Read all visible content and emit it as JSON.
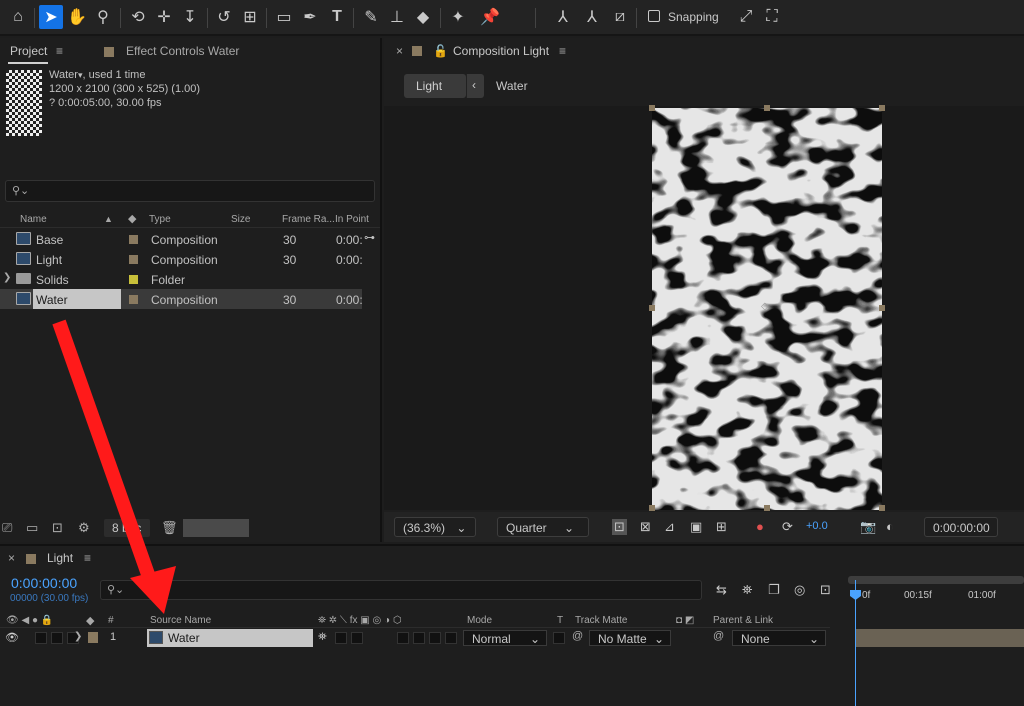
{
  "toolbar": {
    "snapping_label": "Snapping"
  },
  "project_panel": {
    "tab_project": "Project",
    "tab_effect_controls": "Effect Controls Water",
    "selected_item": {
      "name": "Water",
      "usage": ", used 1 time",
      "dimensions": "1200 x 2100  (300 x 525) (1.00)",
      "duration": "? 0:00:05:00, 30.00 fps"
    },
    "columns": {
      "name": "Name",
      "type": "Type",
      "size": "Size",
      "frame_rate": "Frame Ra...",
      "in_point": "In Point"
    },
    "items": [
      {
        "name": "Base",
        "type": "Composition",
        "frame_rate": "30",
        "in_point": "0:00:",
        "color": "#8a7a60",
        "kind": "comp"
      },
      {
        "name": "Light",
        "type": "Composition",
        "frame_rate": "30",
        "in_point": "0:00:",
        "color": "#8a7a60",
        "kind": "comp"
      },
      {
        "name": "Solids",
        "type": "Folder",
        "frame_rate": "",
        "in_point": "",
        "color": "#c8c03a",
        "kind": "folder"
      },
      {
        "name": "Water",
        "type": "Composition",
        "frame_rate": "30",
        "in_point": "0:00:",
        "color": "#8a7a60",
        "kind": "comp"
      }
    ],
    "bpc": "8 bpc"
  },
  "comp_panel": {
    "tab_title": "Composition Light",
    "crumb_active": "Light",
    "crumb_other": "Water",
    "zoom": "(36.3%)",
    "resolution": "Quarter",
    "exposure": "+0.0",
    "timecode": "0:00:00:00"
  },
  "timeline": {
    "tab_title": "Light",
    "timecode": "0:00:00:00",
    "fps_line": "00000 (30.00 fps)",
    "headers": {
      "num": "#",
      "source_name": "Source Name",
      "mode": "Mode",
      "t": "T",
      "track_matte": "Track Matte",
      "parent": "Parent & Link"
    },
    "layer": {
      "index": "1",
      "name": "Water",
      "mode": "Normal",
      "matte": "No Matte",
      "parent": "None"
    },
    "ruler": [
      "0f",
      "00:15f",
      "01:00f"
    ]
  },
  "colors": {
    "accent": "#1473e6",
    "timecode": "#4aa3ff",
    "annotation_arrow": "#ff1a1a"
  }
}
